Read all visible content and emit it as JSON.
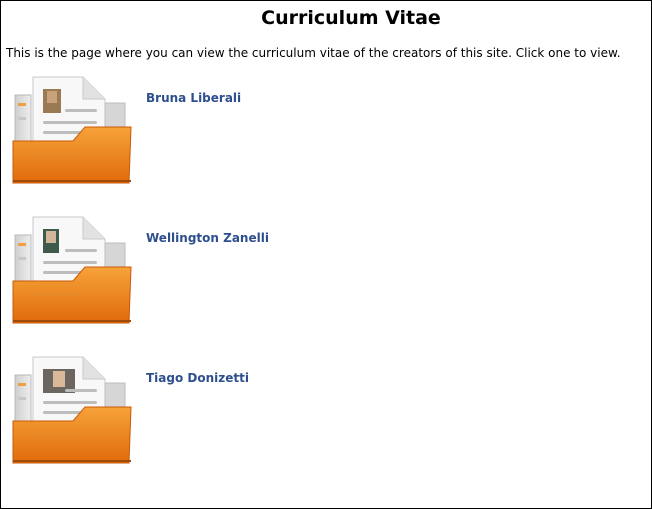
{
  "page": {
    "title": "Curriculum Vitae",
    "intro": "This is the page where you can view the curriculum vitae of the creators of this site. Click one to view."
  },
  "creators": [
    {
      "name": "Bruna Liberali",
      "icon": "cv-folder-icon",
      "avatar": "avatar-photo"
    },
    {
      "name": "Wellington Zanelli",
      "icon": "cv-folder-icon",
      "avatar": "avatar-photo"
    },
    {
      "name": "Tiago Donizetti",
      "icon": "cv-folder-icon",
      "avatar": "avatar-photo"
    }
  ],
  "colors": {
    "link": "#2e4f8e",
    "folder_orange": "#f08a1c",
    "folder_orange_dark": "#d05f0a",
    "document_white": "#f7f7f7"
  }
}
